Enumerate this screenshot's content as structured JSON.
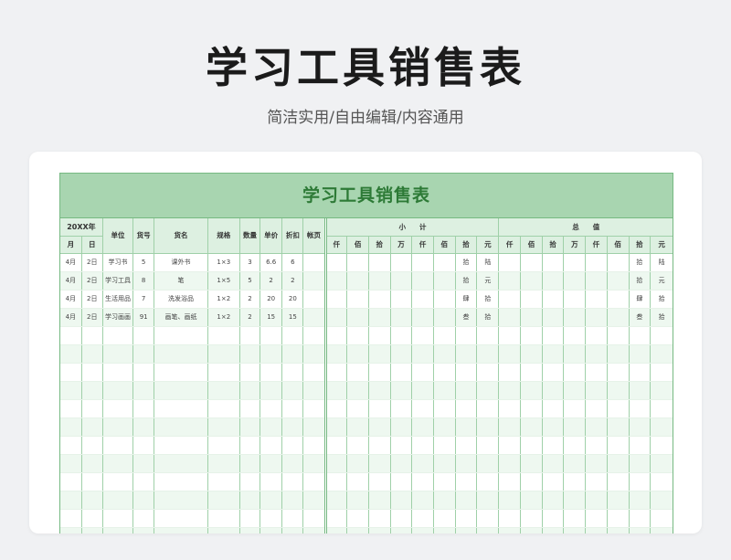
{
  "page": {
    "title": "学习工具销售表",
    "subtitle": "简洁实用/自由编辑/内容通用"
  },
  "sheet": {
    "title": "学习工具销售表",
    "header": {
      "year": "20XX年",
      "month": "月",
      "day": "日",
      "unit": "单位",
      "item_no": "货号",
      "goods_name": "货名",
      "spec": "规格",
      "quantity": "数量",
      "unit_price": "单价",
      "discount": "折扣",
      "page_no": "帐页",
      "subtotal": "小　　计",
      "total": "总　　值",
      "digits": [
        "仟",
        "佰",
        "拾",
        "万",
        "仟",
        "佰",
        "拾",
        "元"
      ]
    },
    "rows": [
      {
        "month": "4月",
        "day": "2日",
        "unit": "学习书",
        "item_no": "5",
        "goods_name": "课外书",
        "spec": "1×3",
        "quantity": "3",
        "unit_price": "6.6",
        "discount": "6",
        "page_no": "",
        "sub_tens": "拾",
        "sub_yuan": "陆",
        "tot_tens": "拾",
        "tot_yuan": "陆"
      },
      {
        "month": "4月",
        "day": "2日",
        "unit": "学习工具",
        "item_no": "8",
        "goods_name": "笔",
        "spec": "1×5",
        "quantity": "5",
        "unit_price": "2",
        "discount": "2",
        "page_no": "",
        "sub_tens": "拾",
        "sub_yuan": "元",
        "tot_tens": "拾",
        "tot_yuan": "元"
      },
      {
        "month": "4月",
        "day": "2日",
        "unit": "生活用品",
        "item_no": "7",
        "goods_name": "洗发浴品",
        "spec": "1×2",
        "quantity": "2",
        "unit_price": "20",
        "discount": "20",
        "page_no": "",
        "sub_tens": "肆",
        "sub_yuan": "拾",
        "tot_tens": "肆",
        "tot_yuan": "拾"
      },
      {
        "month": "4月",
        "day": "2日",
        "unit": "学习画画",
        "item_no": "91",
        "goods_name": "画笔、画纸",
        "spec": "1×2",
        "quantity": "2",
        "unit_price": "15",
        "discount": "15",
        "page_no": "",
        "sub_tens": "叁",
        "sub_yuan": "拾",
        "tot_tens": "叁",
        "tot_yuan": "拾"
      }
    ]
  }
}
